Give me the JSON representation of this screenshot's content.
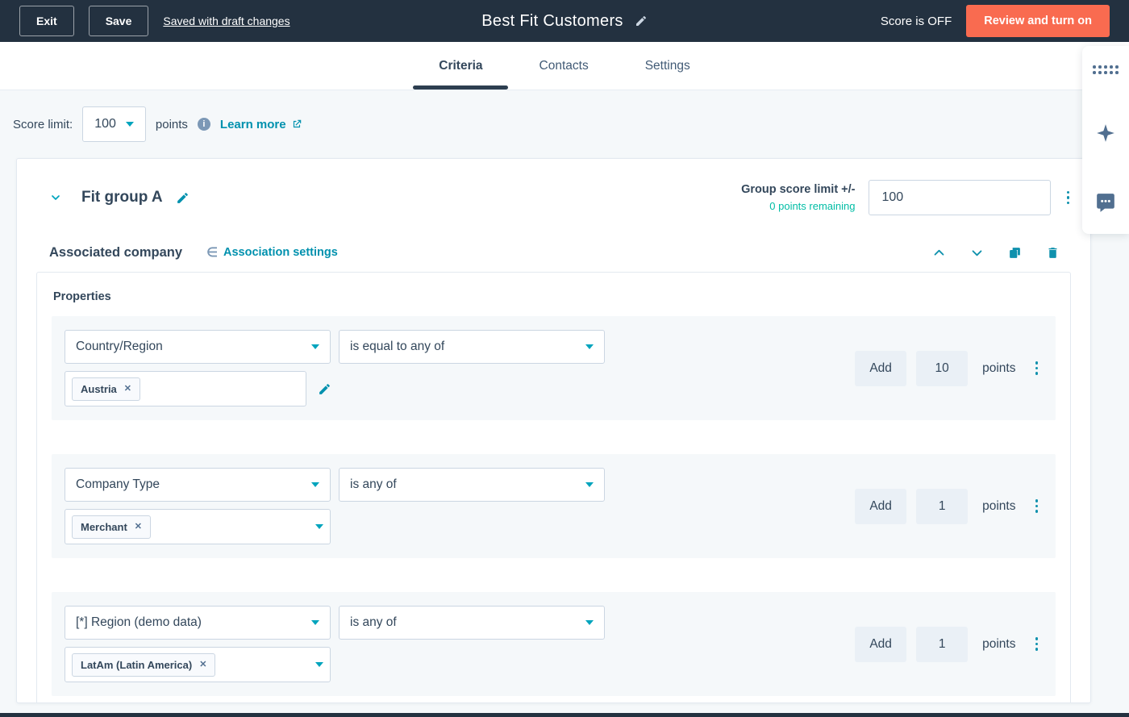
{
  "colors": {
    "header_bg": "#233140",
    "accent_orange": "#f96b50",
    "link_teal": "#0091ae",
    "caret_teal": "#00a4bd",
    "success_green": "#00bda5",
    "text_dark": "#33475b",
    "page_bg": "#f5f8fa",
    "input_border": "#cbd6e2"
  },
  "icons": {
    "title_pencil": "pencil-icon",
    "dropdown_caret": "triangle-down",
    "info": "circled-i",
    "external_link": "arrow-out-of-box",
    "group_chevron": "chevron-down",
    "kebab": "three-vertical-dots",
    "association": "element-of-symbol",
    "move_up": "chevron-up",
    "move_down": "chevron-down",
    "clone": "copy-squares",
    "delete": "trash-can",
    "remove_tag": "x-cross",
    "panel_handle": "grid-of-dots",
    "panel_ai": "four-point-sparkle",
    "panel_comments": "speech-bubble-dots"
  },
  "header": {
    "exit_button": "Exit",
    "save_button": "Save",
    "draft_link": "Saved with draft changes",
    "title": "Best Fit Customers",
    "score_status": "Score is OFF",
    "review_button": "Review and turn on"
  },
  "tabs": {
    "criteria": "Criteria",
    "contacts": "Contacts",
    "settings": "Settings"
  },
  "score_limit": {
    "label": "Score limit:",
    "value": "100",
    "points": "points",
    "learn_more": "Learn more"
  },
  "group": {
    "name": "Fit group A",
    "limit_label": "Group score limit +/-",
    "points_remaining": "0 points remaining",
    "limit_value": "100"
  },
  "association": {
    "title": "Associated company",
    "settings_link": "Association settings"
  },
  "properties": {
    "title": "Properties",
    "rows": [
      {
        "property": "Country/Region",
        "operator": "is equal to any of",
        "tag": "Austria",
        "add": "Add",
        "points_value": "10",
        "points": "points"
      },
      {
        "property": "Company Type",
        "operator": "is any of",
        "tag": "Merchant",
        "add": "Add",
        "points_value": "1",
        "points": "points"
      },
      {
        "property": "[*] Region (demo data)",
        "operator": "is any of",
        "tag": "LatAm (Latin America)",
        "add": "Add",
        "points_value": "1",
        "points": "points"
      }
    ]
  }
}
